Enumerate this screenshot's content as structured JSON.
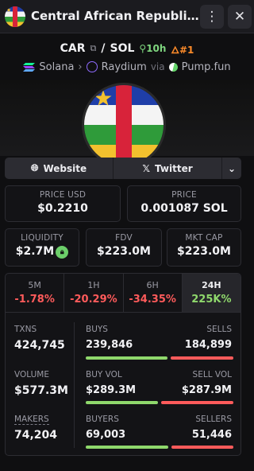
{
  "header": {
    "title": "Central African Republic ...",
    "menu_icon": "⋮",
    "close_icon": "✕"
  },
  "pair": {
    "base": "CAR",
    "separator": "/",
    "quote": "SOL",
    "age": "10h",
    "rank": "#1"
  },
  "chain": {
    "name": "Solana",
    "dex": "Raydium",
    "via": "via",
    "launchpad": "Pump.fun"
  },
  "links": {
    "website": "Website",
    "twitter": "Twitter",
    "more_icon": "⌄"
  },
  "prices": {
    "usd_label": "PRICE USD",
    "usd_value": "$0.2210",
    "native_label": "PRICE",
    "native_value": "0.001087 SOL"
  },
  "metrics": {
    "liquidity_label": "LIQUIDITY",
    "liquidity_value": "$2.7M",
    "fdv_label": "FDV",
    "fdv_value": "$223.0M",
    "mcap_label": "MKT CAP",
    "mcap_value": "$223.0M"
  },
  "timeframes": [
    {
      "label": "5M",
      "change": "-1.78%"
    },
    {
      "label": "1H",
      "change": "-20.29%"
    },
    {
      "label": "6H",
      "change": "-34.35%"
    },
    {
      "label": "24H",
      "change": "225K%"
    }
  ],
  "active_timeframe": "24H",
  "stats": {
    "txns_label": "TXNS",
    "txns_value": "424,745",
    "buys_label": "BUYS",
    "buys_value": "239,846",
    "sells_label": "SELLS",
    "sells_value": "184,899",
    "buys_fraction": 0.565,
    "volume_label": "VOLUME",
    "volume_value": "$577.3M",
    "buy_vol_label": "BUY VOL",
    "buy_vol_value": "$289.3M",
    "sell_vol_label": "SELL VOL",
    "sell_vol_value": "$287.9M",
    "buy_vol_fraction": 0.501,
    "makers_label": "MAKERS",
    "makers_value": "74,204",
    "buyers_label": "BUYERS",
    "buyers_value": "69,003",
    "sellers_label": "SELLERS",
    "sellers_value": "51,446",
    "buyers_fraction": 0.573
  },
  "colors": {
    "positive": "#8fd86c",
    "negative": "#ff5b5b",
    "rank": "#ff8c2a"
  }
}
